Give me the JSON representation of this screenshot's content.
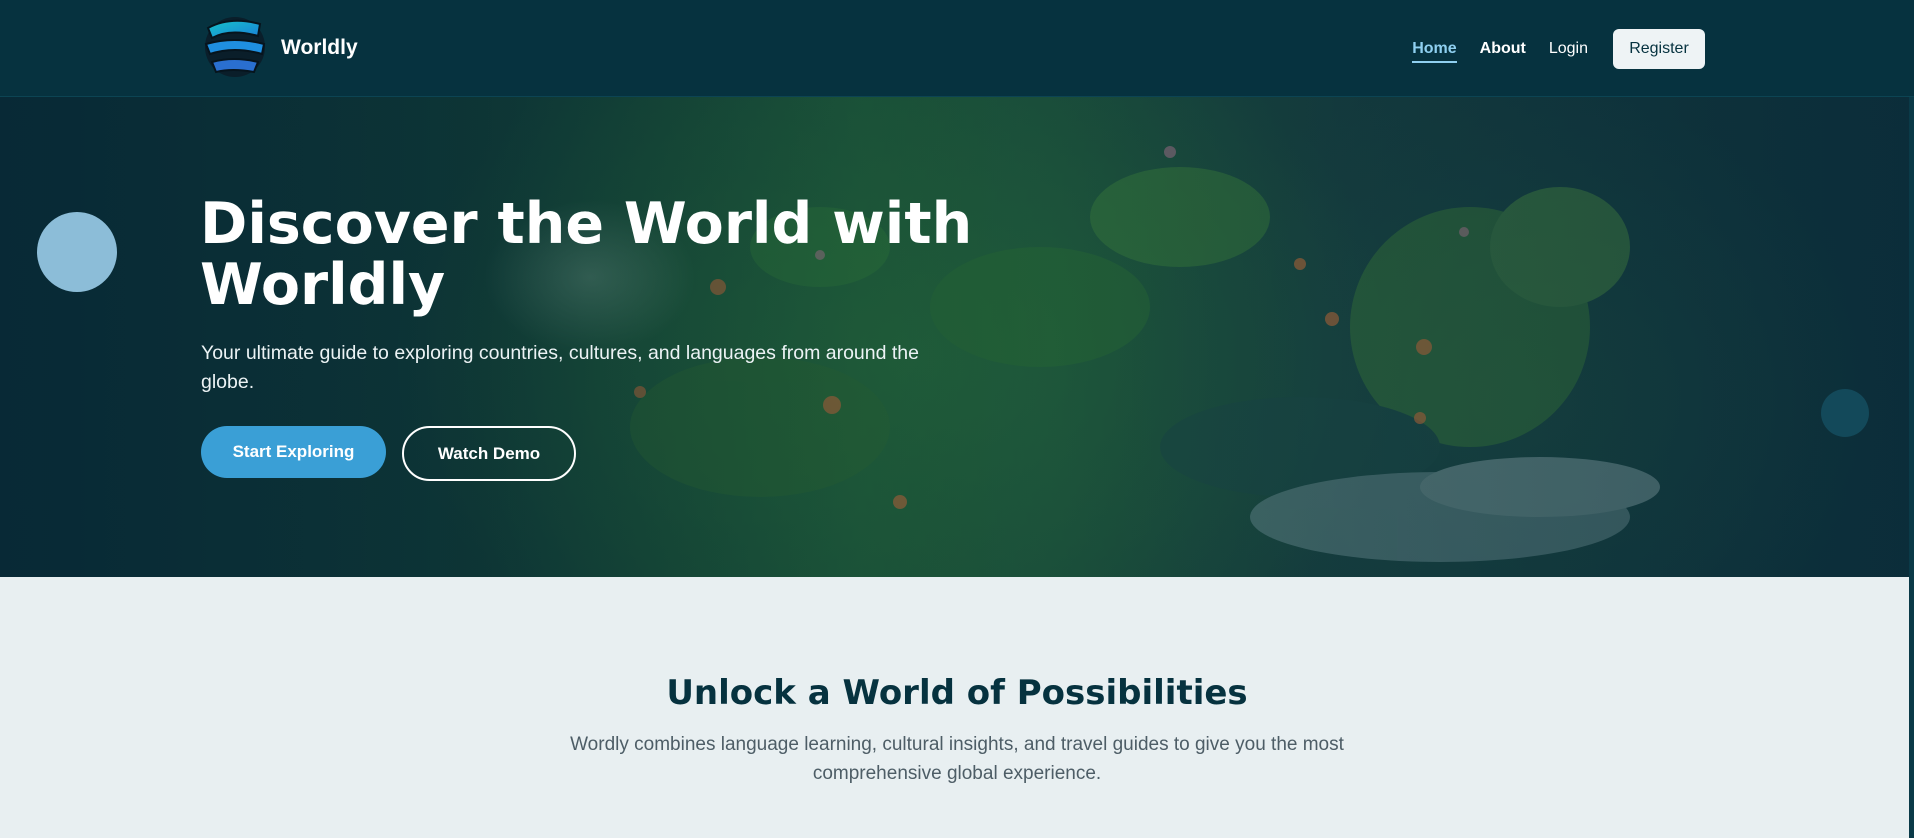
{
  "header": {
    "brand": "Worldly",
    "logo_icon": "globe-logo-icon",
    "nav": {
      "home": "Home",
      "about": "About",
      "login": "Login",
      "register": "Register"
    }
  },
  "hero": {
    "title": "Discover the World with Worldly",
    "subtitle": "Your ultimate guide to exploring countries, cultures, and languages from around the globe.",
    "primary_button": "Start Exploring",
    "secondary_button": "Watch Demo"
  },
  "features": {
    "title": "Unlock a World of Possibilities",
    "subtitle": "Wordly combines language learning, cultural insights, and travel guides to give you the most comprehensive global experience."
  },
  "colors": {
    "header_bg": "#06323f",
    "accent": "#3a9fd6",
    "active_link": "#8fd0f0",
    "section_bg": "#e8eff1",
    "heading_dark": "#06323f"
  }
}
